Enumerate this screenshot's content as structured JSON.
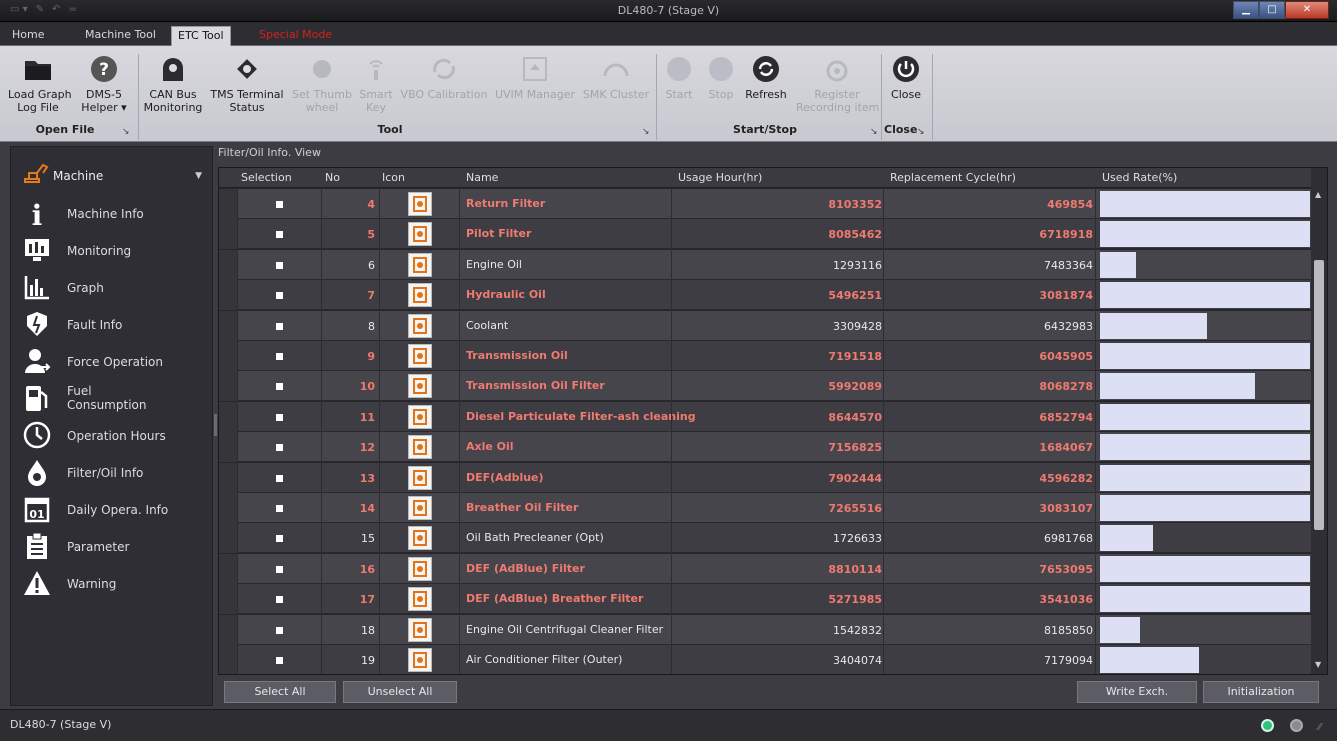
{
  "window": {
    "title": "DL480-7 (Stage V)"
  },
  "tabs": [
    {
      "label": "Home"
    },
    {
      "label": "Machine Tool"
    },
    {
      "label": "ETC Tool"
    },
    {
      "label": "Special Mode"
    }
  ],
  "ribbon": {
    "load_graph": "Load Graph\nLog File",
    "dms5": "DMS-5\nHelper ▾",
    "can_bus": "CAN Bus\nMonitoring",
    "tms": "TMS Terminal\nStatus",
    "thumb": "Set Thumb\nwheel",
    "smart_key": "Smart\nKey",
    "vbo": "VBO Calibration",
    "uvim": "UVIM Manager",
    "smk": "SMK Cluster",
    "start": "Start",
    "stop": "Stop",
    "refresh": "Refresh",
    "register": "Register\nRecording item",
    "close": "Close",
    "groups": {
      "open_file": "Open File",
      "tool": "Tool",
      "start_stop": "Start/Stop",
      "close": "Close"
    }
  },
  "sidebar": {
    "header": "Machine",
    "items": [
      {
        "label": "Machine Info",
        "icon": "info-icon"
      },
      {
        "label": "Monitoring",
        "icon": "monitor-icon"
      },
      {
        "label": "Graph",
        "icon": "graph-icon"
      },
      {
        "label": "Fault Info",
        "icon": "fault-icon"
      },
      {
        "label": "Force Operation",
        "icon": "force-operation-icon"
      },
      {
        "label": "Fuel\nConsumption",
        "icon": "fuel-icon"
      },
      {
        "label": "Operation Hours",
        "icon": "clock-icon"
      },
      {
        "label": "Filter/Oil Info",
        "icon": "oil-drop-icon"
      },
      {
        "label": "Daily Opera. Info",
        "icon": "calendar-icon"
      },
      {
        "label": "Parameter",
        "icon": "clipboard-icon"
      },
      {
        "label": "Warning",
        "icon": "warning-icon"
      }
    ]
  },
  "view_title": "Filter/Oil Info. View",
  "table": {
    "columns": [
      "Selection",
      "No",
      "Icon",
      "Name",
      "Usage Hour(hr)",
      "Replacement Cycle(hr)",
      "Used Rate(%)"
    ],
    "rows": [
      {
        "no": "4",
        "name": "Return Filter",
        "usage": "8103352",
        "cycle": "469854",
        "rate": 1.0,
        "warn": true
      },
      {
        "no": "5",
        "name": "Pilot Filter",
        "usage": "8085462",
        "cycle": "6718918",
        "rate": 1.0,
        "warn": true
      },
      {
        "no": "6",
        "name": "Engine Oil",
        "usage": "1293116",
        "cycle": "7483364",
        "rate": 0.17,
        "warn": false
      },
      {
        "no": "7",
        "name": "Hydraulic Oil",
        "usage": "5496251",
        "cycle": "3081874",
        "rate": 1.0,
        "warn": true
      },
      {
        "no": "8",
        "name": "Coolant",
        "usage": "3309428",
        "cycle": "6432983",
        "rate": 0.51,
        "warn": false
      },
      {
        "no": "9",
        "name": "Transmission Oil",
        "usage": "7191518",
        "cycle": "6045905",
        "rate": 1.0,
        "warn": true
      },
      {
        "no": "10",
        "name": "Transmission Oil Filter",
        "usage": "5992089",
        "cycle": "8068278",
        "rate": 0.74,
        "warn": true
      },
      {
        "no": "11",
        "name": "Diesel Particulate Filter-ash cleaning",
        "usage": "8644570",
        "cycle": "6852794",
        "rate": 1.0,
        "warn": true
      },
      {
        "no": "12",
        "name": "Axle Oil",
        "usage": "7156825",
        "cycle": "1684067",
        "rate": 1.0,
        "warn": true
      },
      {
        "no": "13",
        "name": "DEF(Adblue)",
        "usage": "7902444",
        "cycle": "4596282",
        "rate": 1.0,
        "warn": true
      },
      {
        "no": "14",
        "name": "Breather Oil Filter",
        "usage": "7265516",
        "cycle": "3083107",
        "rate": 1.0,
        "warn": true
      },
      {
        "no": "15",
        "name": "Oil Bath Precleaner (Opt)",
        "usage": "1726633",
        "cycle": "6981768",
        "rate": 0.25,
        "warn": false
      },
      {
        "no": "16",
        "name": "DEF (AdBlue) Filter",
        "usage": "8810114",
        "cycle": "7653095",
        "rate": 1.0,
        "warn": true
      },
      {
        "no": "17",
        "name": "DEF (AdBlue) Breather Filter",
        "usage": "5271985",
        "cycle": "3541036",
        "rate": 1.0,
        "warn": true
      },
      {
        "no": "18",
        "name": "Engine Oil Centrifugal Cleaner Filter",
        "usage": "1542832",
        "cycle": "8185850",
        "rate": 0.19,
        "warn": false
      },
      {
        "no": "19",
        "name": "Air Conditioner Filter (Outer)",
        "usage": "3404074",
        "cycle": "7179094",
        "rate": 0.47,
        "warn": false
      }
    ]
  },
  "buttons": {
    "select_all": "Select All",
    "unselect_all": "Unselect All",
    "write_exch": "Write Exch.",
    "initialization": "Initialization"
  },
  "status": {
    "text": "DL480-7 (Stage V)"
  },
  "colors": {
    "warn_text": "#f07a70",
    "bar": "#dde0f5",
    "led_on": "#34c27a",
    "led_off": "#8a8a92"
  }
}
